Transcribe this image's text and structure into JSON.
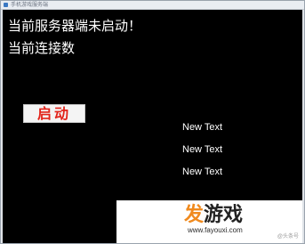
{
  "window": {
    "title": "手机游戏服务端"
  },
  "status": {
    "server_status": "当前服务器端未启动！",
    "connection_count_label": "当前连接数"
  },
  "controls": {
    "start_button_label": "启动"
  },
  "text_labels": [
    "New Text",
    "New Text",
    "New Text"
  ],
  "watermark": {
    "logo_first": "发",
    "logo_rest": "游戏",
    "url": "www.fayouxi.com",
    "credit": "@头条号"
  },
  "colors": {
    "background": "#000000",
    "text": "#ffffff",
    "start_button_text": "#e2231a",
    "logo_accent": "#f08a1e"
  }
}
